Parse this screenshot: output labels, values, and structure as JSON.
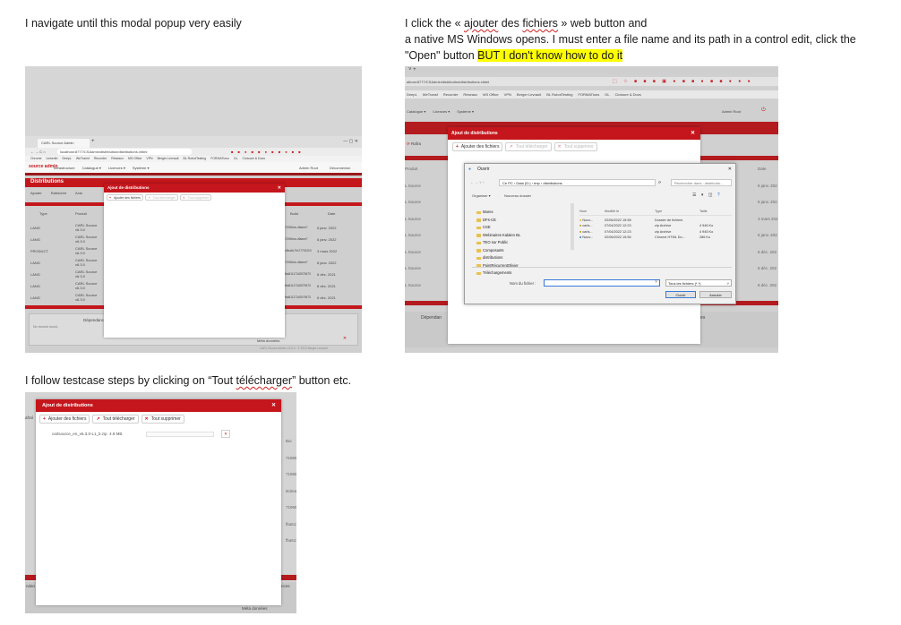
{
  "captions": {
    "c1": "I navigate until this modal popup very easily",
    "c2_a": "I click the « ",
    "c2_b": "ajouter",
    "c2_c": " des ",
    "c2_d": "fichiers",
    "c2_e": " » web button and",
    "c2_line2": "a native MS Windows opens. I must enter a file name and its path in a control edit, click the",
    "c2_line3_pre": "\"Open\" button ",
    "c2_highlight": "BUT I don't know how to do it",
    "c3_pre": "I follow testcase steps by clicking on “Tout ",
    "c3_word": "télécharger",
    "c3_post": "” button etc."
  },
  "shot1": {
    "browser_tab": "CARL Source Admin",
    "url": "localhost:8777/CSAdmin/distribution/distributions.xhtml",
    "bookmarks": [
      "Chrome",
      "Linkedin",
      "DeepL",
      "WeTransf",
      "Recorder",
      "Réseaux",
      "MS Office",
      "VPN",
      "Berger Levrault",
      "BL RobotTesting",
      "FORMATions",
      "GL",
      "Clotoure & Docs"
    ],
    "logo": "source admin",
    "menu": [
      "Infrastructure",
      "Catalogue ▾",
      "Licences ▾",
      "Système ▾"
    ],
    "user": "Admin Root",
    "logout": "Déconnexion",
    "page_title": "Distributions",
    "toolbar": [
      "Ajouter",
      "Rafraîchir",
      "Actu"
    ],
    "columns": [
      "Type",
      "Produit",
      "Build",
      "Date"
    ],
    "rows": [
      {
        "type": "LANG",
        "product": "CARL Source v6.3.0",
        "build": "7196fcbc-dfaaee7",
        "date": "6 janv. 2022"
      },
      {
        "type": "LANG",
        "product": "CARL Source v6.3.0",
        "build": "7196fcbc-dfaaee7",
        "date": "6 janv. 2022"
      },
      {
        "type": "PRODUCT",
        "product": "CARL Source v6.3.0",
        "build": "c9ba5c79c77702203",
        "date": "3 mars 2022"
      },
      {
        "type": "LANG",
        "product": "CARL Source v6.3.0",
        "build": "7196fcbc-dfaaee7",
        "date": "6 janv. 2022"
      },
      {
        "type": "LANG",
        "product": "CARL Source v6.3.0",
        "build": "fba811172d2579673",
        "date": "6 déc. 2021"
      },
      {
        "type": "LANG",
        "product": "CARL Source v6.3.0",
        "build": "fba811172d2579673",
        "date": "6 déc. 2021"
      },
      {
        "type": "LANG",
        "product": "CARL Source v6.3.0",
        "build": "fba811172d2579673",
        "date": "6 déc. 2021"
      }
    ],
    "deps_title": "Dépendances",
    "deps_empty": "No records found.",
    "meta_label": "Méta données",
    "footer": "CARL Source Admin v 6.3.0 - © 2022 Berger-Levrault",
    "modal": {
      "title": "Ajout de distributions",
      "close": "✕",
      "btn_add": "Ajouter des fichiers",
      "btn_upload": "Tout télécharger",
      "btn_delete": "Tout supprimer"
    }
  },
  "shot2": {
    "url": "alhost:8777/CSAdmin/distribution/distributions.xhtml",
    "bookmarks": [
      "DeepL",
      "WeTransf",
      "Recorder",
      "Réseaux",
      "MS Office",
      "VPN",
      "Berger Levrault",
      "BL RobotTesting",
      "FORMATions",
      "GL",
      "Clotoure & Docs"
    ],
    "menu": [
      "Catalogue ▾",
      "Licences ▾",
      "Système ▾"
    ],
    "user": "Admin Root",
    "left_labels": [
      "Produit",
      "L Source",
      "L Source",
      "L Source",
      "L Source",
      "L Source",
      "L Source",
      "L Source"
    ],
    "right_dates": [
      "Date",
      "6 janv. 202",
      "6 janv. 202",
      "3 mars 202",
      "6 janv. 202",
      "6 déc. 202",
      "6 déc. 202",
      "6 déc. 202"
    ],
    "refresh": "Rafra",
    "deps": "Dépendan",
    "deps_right": "ances",
    "meta": "Méta données",
    "modal": {
      "title": "Ajout de distributions",
      "close": "✕",
      "btn_add": "Ajouter des fichiers",
      "btn_upload": "Tout télécharger",
      "btn_delete": "Tout supprimer"
    },
    "dialog": {
      "title": "Ouvrir",
      "close": "✕",
      "path": "Ce PC  ›  Data (D:)  ›  tmp  ›  distributions",
      "search": "Rechercher dans : distributio...",
      "organise": "Organiser ▾",
      "new_folder": "Nouveau dossier",
      "tree": [
        "Marex",
        "DFs-CE",
        "CSE",
        "Webinaires Kalalen BL",
        "TEO sur Public",
        "Composants",
        "distributions",
        "PointRécurrentOlivier",
        "Téléchargements"
      ],
      "col_name": "Nom",
      "col_modified": "Modifié le",
      "col_type": "Type",
      "col_size": "Taille",
      "files": [
        {
          "name": "Nouv...",
          "date": "02/06/2022 15:58",
          "type": "Dossier de fichiers",
          "size": ""
        },
        {
          "name": "carls...",
          "date": "07/04/2022 12:23",
          "type": "zip Archive",
          "size": "4 946 Ko"
        },
        {
          "name": "carls...",
          "date": "07/04/2022 12:23",
          "type": "zip Archive",
          "size": "4 945 Ko"
        },
        {
          "name": "Nouv...",
          "date": "02/06/2022 15:56",
          "type": "Chrome HTML Do...",
          "size": "286 Ko"
        }
      ],
      "filename_label": "Nom du fichier :",
      "filter": "Tous les fichiers (*.*)",
      "open": "Ouvrir",
      "cancel": "Annuler"
    }
  },
  "shot3": {
    "modal": {
      "title": "Ajout de distributions",
      "close": "✕",
      "btn_add": "Ajouter des fichiers",
      "btn_upload": "Tout télécharger",
      "btn_delete": "Tout supprimer"
    },
    "file_name": "carlsource_en_v6.3.0-L1_b.zip",
    "file_size": "4.8 MB",
    "remove": "✕",
    "refresh": "afraî",
    "bg_labels": [
      "Bui",
      "71965c",
      "71965c",
      "9c0ea5",
      "71965c",
      "fba511",
      "fba511"
    ],
    "deps": "ndan",
    "deps_right": "nces",
    "meta": "Méta données"
  },
  "colors": {
    "brand_red": "#c4161c",
    "highlight": "#ffff00"
  }
}
